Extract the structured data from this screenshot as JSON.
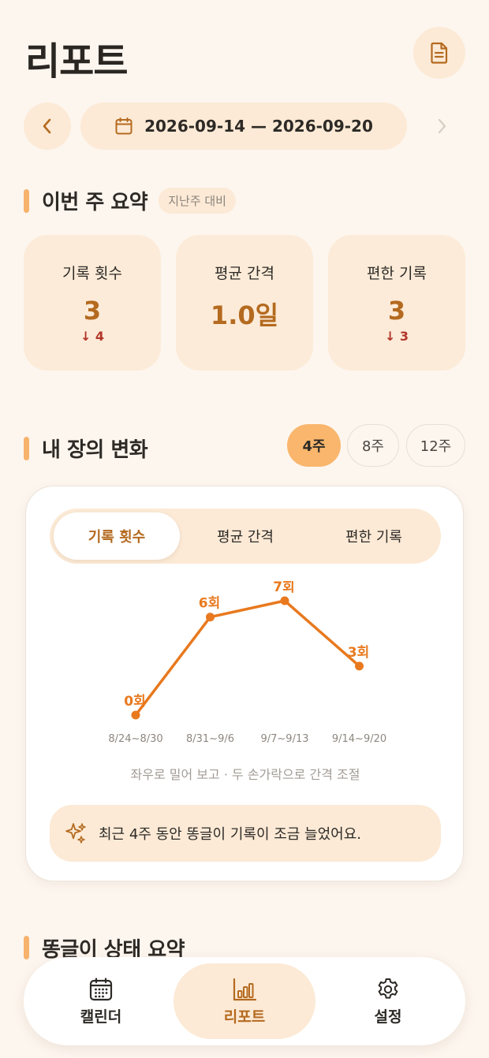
{
  "header": {
    "title": "리포트",
    "doc_icon": "document-icon"
  },
  "date_nav": {
    "prev_icon": "chevron-left-icon",
    "next_icon": "chevron-right-icon",
    "calendar_icon": "calendar-icon",
    "range_text": "2026-09-14 — 2026-09-20"
  },
  "summary": {
    "title": "이번 주 요약",
    "badge": "지난주 대비",
    "cards": [
      {
        "label": "기록 횟수",
        "value": "3",
        "delta": "↓ 4"
      },
      {
        "label": "평균 간격",
        "value": "1.0일",
        "delta": ""
      },
      {
        "label": "편한 기록",
        "value": "3",
        "delta": "↓ 3"
      }
    ]
  },
  "trend": {
    "title": "내 장의 변화",
    "ranges": [
      "4주",
      "8주",
      "12주"
    ],
    "active_range": "4주",
    "tabs": [
      "기록 횟수",
      "평균 간격",
      "편한 기록"
    ],
    "active_tab": "기록 횟수",
    "hint": "좌우로 밀어 보고 · 두 손가락으로 간격 조절",
    "insight_icon": "sparkle-icon",
    "insight": "최근 4주 동안 똥글이 기록이 조금 늘었어요."
  },
  "chart_data": {
    "type": "line",
    "categories": [
      "8/24~8/30",
      "8/31~9/6",
      "9/7~9/13",
      "9/14~9/20"
    ],
    "series": [
      {
        "values": [
          0,
          6,
          7,
          3
        ],
        "labels": [
          "0회",
          "6회",
          "7회",
          "3회"
        ]
      }
    ],
    "color": "#e8791e",
    "title": "",
    "xlabel": "",
    "ylabel": "",
    "ylim": [
      0,
      7
    ]
  },
  "next_section": {
    "title": "똥글이 상태 요약"
  },
  "bottom_nav": {
    "items": [
      {
        "label": "캘린더",
        "icon": "calendar-grid-icon"
      },
      {
        "label": "리포트",
        "icon": "bar-chart-icon"
      },
      {
        "label": "설정",
        "icon": "gear-icon"
      }
    ],
    "active": "리포트"
  },
  "colors": {
    "background": "#fdf6ef",
    "accent": "#f9b66c",
    "accent_dark": "#b46a1f",
    "decrease": "#b3362a",
    "chart_line": "#e8791e"
  }
}
